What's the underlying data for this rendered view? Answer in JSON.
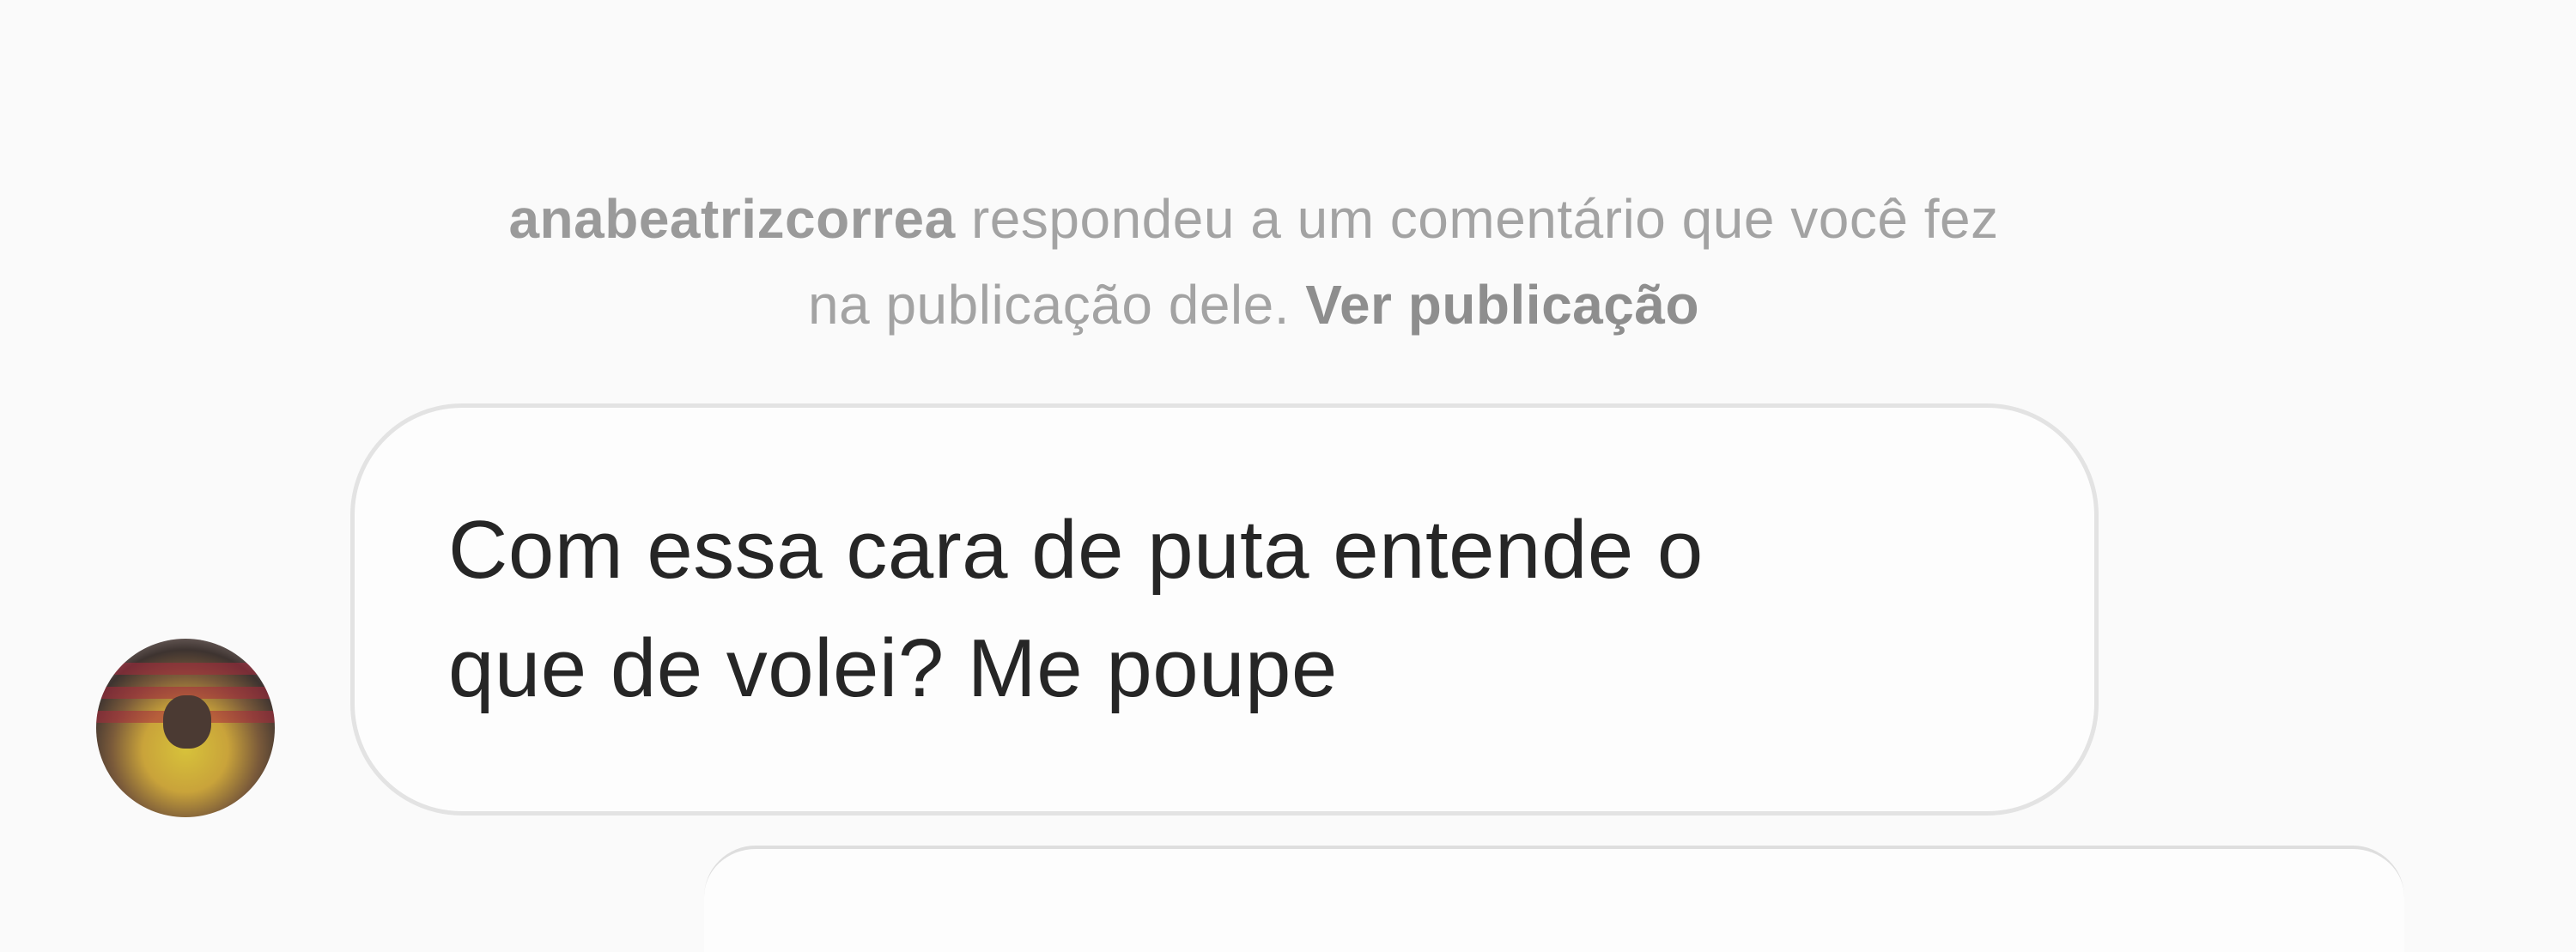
{
  "notification": {
    "username": "anabeatrizcorrea",
    "text_line1": " respondeu a um comentário que você fez",
    "text_line2": "na publicação dele. ",
    "link_label": "Ver publicação"
  },
  "message": {
    "line1": "Com essa cara de puta entende o",
    "line2": "que de volei? Me poupe"
  },
  "colors": {
    "background": "#fafafa",
    "notice_text": "#a3a3a3",
    "message_text": "#262626",
    "bubble_border": "#e3e3e3"
  },
  "icons": {
    "avatar": "profile-photo"
  }
}
